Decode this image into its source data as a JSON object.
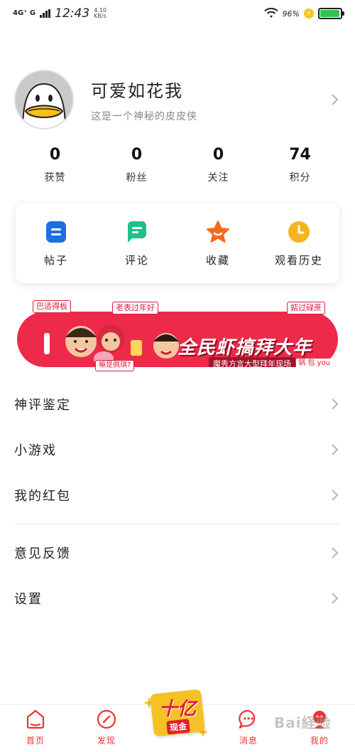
{
  "status_bar": {
    "network": "4G⁺ G",
    "time": "12:43",
    "speed": "4.10",
    "speed_unit": "KB/s",
    "battery_pct": "96%",
    "battery_level": 0.96
  },
  "profile": {
    "username": "可爱如花我",
    "bio": "这是一个神秘的皮皮侠"
  },
  "stats": [
    {
      "value": "0",
      "label": "获赞"
    },
    {
      "value": "0",
      "label": "粉丝"
    },
    {
      "value": "0",
      "label": "关注"
    },
    {
      "value": "74",
      "label": "积分"
    }
  ],
  "quick_actions": [
    {
      "label": "帖子",
      "icon": "post-icon",
      "color": "#1e6fe0"
    },
    {
      "label": "评论",
      "icon": "comment-icon",
      "color": "#1fc08a"
    },
    {
      "label": "收藏",
      "icon": "star-icon",
      "color": "#f26b1d"
    },
    {
      "label": "观看历史",
      "icon": "clock-icon",
      "color": "#f5b41c"
    }
  ],
  "banner": {
    "tag_left": "巴适得板",
    "tag_mid": "老表过年好",
    "tag_right": "掂过碌蔗",
    "tag_bottom": "嘛是佩琪?",
    "title": "全民虾搞拜大年",
    "subtitle": "魔秀方言大型拜年现场",
    "badge": "锅 包 you",
    "accent": "#ee2a4a"
  },
  "menu": {
    "group1": [
      {
        "label": "神评鉴定"
      },
      {
        "label": "小游戏"
      },
      {
        "label": "我的红包"
      }
    ],
    "group2": [
      {
        "label": "意见反馈"
      },
      {
        "label": "设置"
      }
    ]
  },
  "bottom_nav": {
    "items": [
      {
        "label": "首页",
        "icon": "home-icon"
      },
      {
        "label": "发现",
        "icon": "compass-icon"
      },
      {
        "label": "消息",
        "icon": "message-icon"
      },
      {
        "label": "我的",
        "icon": "profile-icon"
      }
    ],
    "promo_main": "十亿",
    "promo_sub": "现金",
    "accent": "#e33333"
  },
  "watermark": "Bai経验"
}
